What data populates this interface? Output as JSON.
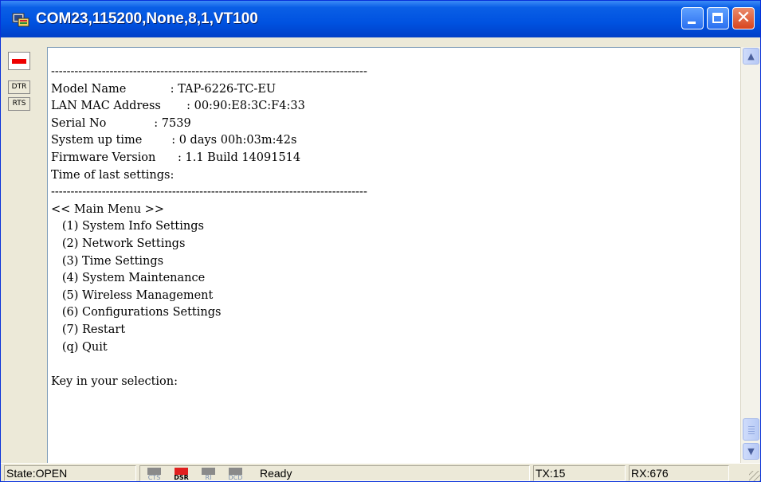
{
  "window": {
    "title": "COM23,115200,None,8,1,VT100",
    "icon": "terminal-app-icon"
  },
  "left_panel": {
    "signals": [
      "DTR",
      "RTS"
    ]
  },
  "terminal": {
    "lines": [
      "---------------------------------------------------------------------------------",
      "Model Name            : TAP-6226-TC-EU",
      "LAN MAC Address       : 00:90:E8:3C:F4:33",
      "Serial No             : 7539",
      "System up time        : 0 days 00h:03m:42s",
      "Firmware Version      : 1.1 Build 14091514",
      "Time of last settings:",
      "---------------------------------------------------------------------------------",
      "<< Main Menu >>",
      "   (1) System Info Settings",
      "   (2) Network Settings",
      "   (3) Time Settings",
      "   (4) System Maintenance",
      "   (5) Wireless Management",
      "   (6) Configurations Settings",
      "   (7) Restart",
      "   (q) Quit",
      "",
      "Key in your selection:"
    ]
  },
  "status": {
    "state": "State:OPEN",
    "leds": [
      {
        "label": "CTS",
        "active": false
      },
      {
        "label": "DSR",
        "active": true
      },
      {
        "label": "RI",
        "active": false
      },
      {
        "label": "DCD",
        "active": false
      }
    ],
    "message": "Ready",
    "tx": "TX:15",
    "rx": "RX:676"
  },
  "colors": {
    "titlebar": "#0052e0",
    "led_active": "#e02020",
    "led_inactive": "#8a8a8a",
    "lamp": "#e00000"
  }
}
